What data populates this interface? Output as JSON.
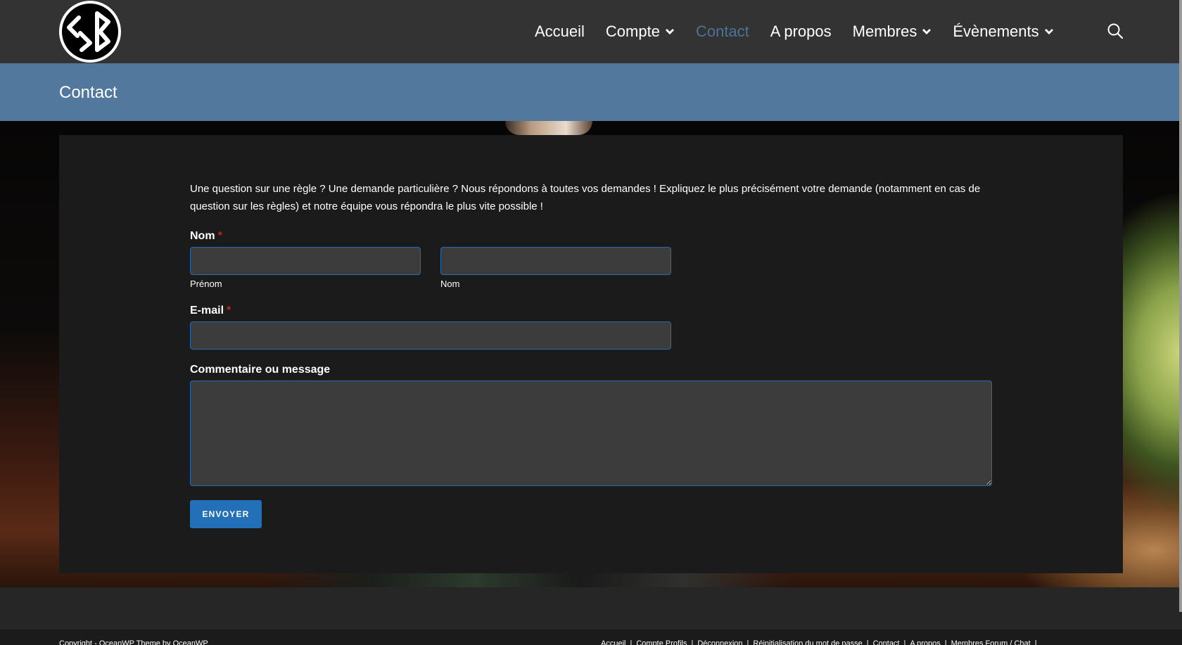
{
  "header": {
    "logo_alt": "CSB",
    "nav": [
      {
        "label": "Accueil",
        "dropdown": false,
        "active": false
      },
      {
        "label": "Compte",
        "dropdown": true,
        "active": false
      },
      {
        "label": "Contact",
        "dropdown": false,
        "active": true
      },
      {
        "label": "A propos",
        "dropdown": false,
        "active": false
      },
      {
        "label": "Membres",
        "dropdown": true,
        "active": false
      },
      {
        "label": "Évènements",
        "dropdown": true,
        "active": false
      }
    ],
    "search_icon": "search-icon"
  },
  "page": {
    "title": "Contact"
  },
  "form": {
    "intro": "Une question sur une règle ? Une demande particulière ? Nous répondons à toutes vos demandes ! Expliquez le plus précisément votre demande (notamment en cas de question sur les règles) et notre équipe vous répondra le plus vite possible !",
    "name_label": "Nom",
    "required_mark": "*",
    "first_name": {
      "value": "",
      "sublabel": "Prénom"
    },
    "last_name": {
      "value": "",
      "sublabel": "Nom"
    },
    "email_label": "E-mail",
    "email": {
      "value": ""
    },
    "message_label": "Commentaire ou message",
    "message": {
      "value": ""
    },
    "submit_label": "ENVOYER"
  },
  "footer": {
    "copyright": "Copyright - OceanWP Theme by OceanWP",
    "links": [
      "Accueil",
      "Compte Profils",
      "Déconnexion",
      "Réinitialisation du mot de passe",
      "Contact",
      "A propos",
      "Membres Forum / Chat"
    ],
    "separator": "|"
  },
  "colors": {
    "header_bg": "#333333",
    "title_band": "#52789e",
    "active_nav": "#4d7299",
    "card_bg": "#1b1b1b",
    "field_bg": "#3c3c3c",
    "field_border": "#2a6bb0",
    "button_bg": "#2470b8",
    "required": "#c02b0a"
  }
}
